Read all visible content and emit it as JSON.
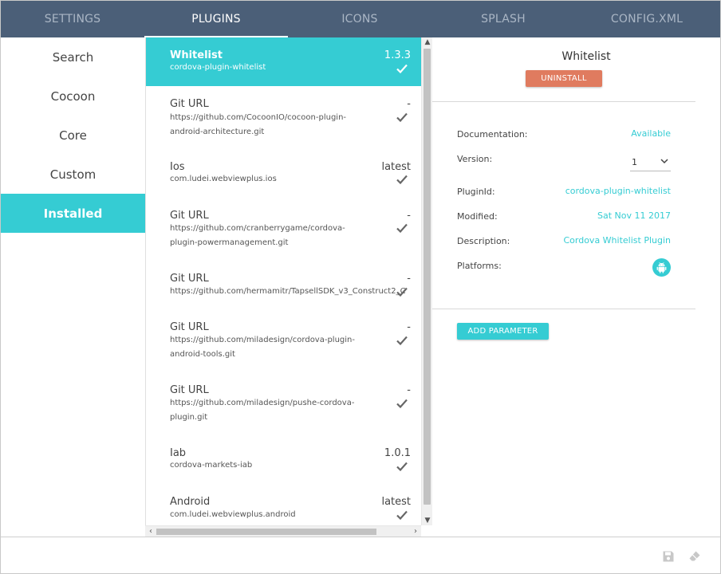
{
  "tabs": [
    {
      "label": "SETTINGS"
    },
    {
      "label": "PLUGINS"
    },
    {
      "label": "ICONS"
    },
    {
      "label": "SPLASH"
    },
    {
      "label": "CONFIG.XML"
    }
  ],
  "categories": [
    {
      "label": "Search"
    },
    {
      "label": "Cocoon"
    },
    {
      "label": "Core"
    },
    {
      "label": "Custom"
    },
    {
      "label": "Installed"
    }
  ],
  "plugins": [
    {
      "title": "Whitelist",
      "subtitle": "cordova-plugin-whitelist",
      "version": "1.3.3",
      "selected": true
    },
    {
      "title": "Git URL",
      "subtitle": "https://github.com/CocoonIO/cocoon-plugin-android-architecture.git",
      "version": "-"
    },
    {
      "title": "Ios",
      "subtitle": "com.ludei.webviewplus.ios",
      "version": "latest"
    },
    {
      "title": "Git URL",
      "subtitle": "https://github.com/cranberrygame/cordova-plugin-powermanagement.git",
      "version": "-"
    },
    {
      "title": "Git URL",
      "subtitle": "https://github.com/hermamitr/TapsellSDK_v3_Construct2_C",
      "version": "-"
    },
    {
      "title": "Git URL",
      "subtitle": "https://github.com/miladesign/cordova-plugin-android-tools.git",
      "version": "-"
    },
    {
      "title": "Git URL",
      "subtitle": "https://github.com/miladesign/pushe-cordova-plugin.git",
      "version": "-"
    },
    {
      "title": "Iab",
      "subtitle": "cordova-markets-iab",
      "version": "1.0.1"
    },
    {
      "title": "Android",
      "subtitle": "com.ludei.webviewplus.android",
      "version": "latest"
    }
  ],
  "details": {
    "title": "Whitelist",
    "uninstall_label": "UNINSTALL",
    "documentation_label": "Documentation:",
    "documentation_value": "Available",
    "version_label": "Version:",
    "version_value": "1",
    "pluginid_label": "PluginId:",
    "pluginid_value": "cordova-plugin-whitelist",
    "modified_label": "Modified:",
    "modified_value": "Sat Nov 11 2017",
    "description_label": "Description:",
    "description_value": "Cordova Whitelist Plugin",
    "platforms_label": "Platforms:",
    "platform_icon": "android-icon",
    "add_parameter_label": "ADD PARAMETER"
  },
  "footer": {
    "save_icon": "save-icon",
    "erase_icon": "eraser-icon"
  },
  "colors": {
    "accent": "#35ccd3",
    "topbar": "#4b5f78",
    "uninstall": "#e07b5f"
  }
}
